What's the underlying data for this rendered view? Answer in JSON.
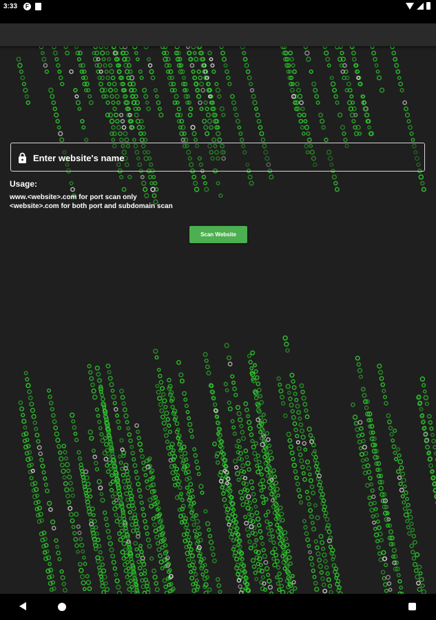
{
  "status_bar": {
    "time": "3:33",
    "icons": [
      "notification-f-icon",
      "clipboard-icon",
      "wifi-icon",
      "signal-icon",
      "battery-icon"
    ]
  },
  "search": {
    "placeholder": "Enter website's name",
    "value": ""
  },
  "usage": {
    "title": "Usage:",
    "lines": [
      "www.<website>.com for port scan only",
      "<website>.com for both port and subdomain scan"
    ]
  },
  "scan_button": {
    "label": "Scan Website"
  },
  "colors": {
    "background": "#1f1f1f",
    "accent": "#4caf50",
    "matrix_green": "#2ecc2e",
    "matrix_white": "#dcdcdc"
  },
  "nav_bar": {
    "icons": [
      "back-icon",
      "home-icon",
      "recents-icon"
    ]
  }
}
